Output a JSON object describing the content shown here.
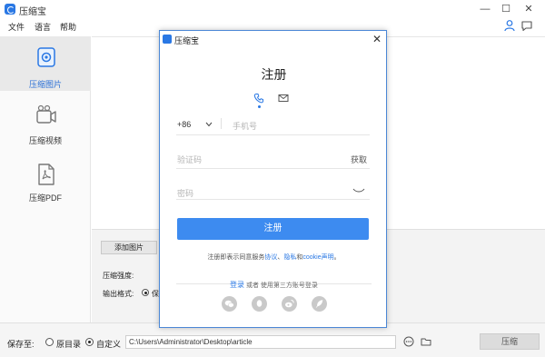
{
  "app": {
    "title": "压缩宝"
  },
  "window": {
    "minimize": "—",
    "maximize": "☐",
    "close": "✕"
  },
  "menu": [
    "文件",
    "语言",
    "帮助"
  ],
  "sidebar": {
    "items": [
      {
        "label": "压缩图片",
        "icon": "image-compress-icon",
        "active": true
      },
      {
        "label": "压缩视频",
        "icon": "video-compress-icon",
        "active": false
      },
      {
        "label": "压缩PDF",
        "icon": "pdf-compress-icon",
        "active": false
      }
    ]
  },
  "panel": {
    "add_button": "添加图片",
    "strength_label": "压缩强度:",
    "format_label": "输出格式:",
    "format_value": "保"
  },
  "footer": {
    "save_to": "保存至:",
    "option_original": "原目录",
    "option_custom": "自定义",
    "selected": "custom",
    "path": "C:\\Users\\Administrator\\Desktop\\article",
    "compress_button": "压缩"
  },
  "dialog": {
    "title": "压缩宝",
    "heading": "注册",
    "country_code": "+86",
    "phone_placeholder": "手机号",
    "code_placeholder": "验证码",
    "get_code": "获取",
    "password_placeholder": "密码",
    "submit": "注册",
    "terms_prefix": "注册即表示同意服务",
    "terms_link1": "协议",
    "terms_sep": "、",
    "terms_link2": "隐私",
    "terms_and": "和",
    "terms_link3": "cookie声明",
    "terms_end": "。",
    "login_link": "登录",
    "login_rest": " 或者 使用第三方账号登录"
  },
  "colors": {
    "accent": "#3d8bf0",
    "brand": "#2a78e4"
  }
}
